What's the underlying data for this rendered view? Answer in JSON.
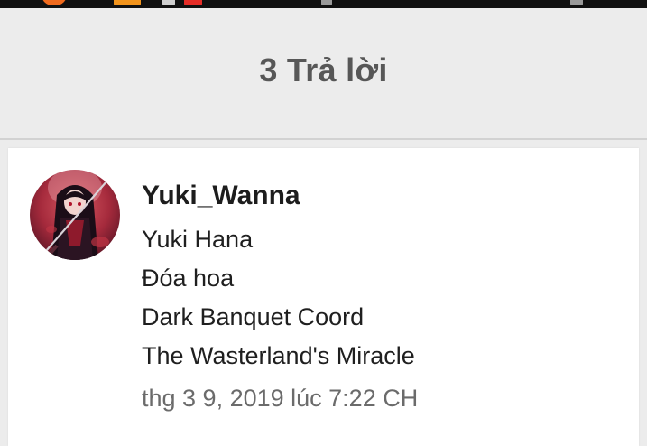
{
  "header": {
    "title": "3 Trả lời"
  },
  "reply": {
    "avatar_icon": "user-avatar",
    "username": "Yuki_Wanna",
    "lines": [
      "Yuki Hana",
      "Đóa hoa",
      "Dark Banquet Coord",
      "The Wasterland's Miracle"
    ],
    "timestamp": "thg 3 9, 2019 lúc 7:22 CH"
  },
  "colors": {
    "status_bar": "#111111",
    "header_bg": "#ececec",
    "title_text": "#575757",
    "card_bg": "#ffffff",
    "timestamp_text": "#6b6b6b"
  }
}
